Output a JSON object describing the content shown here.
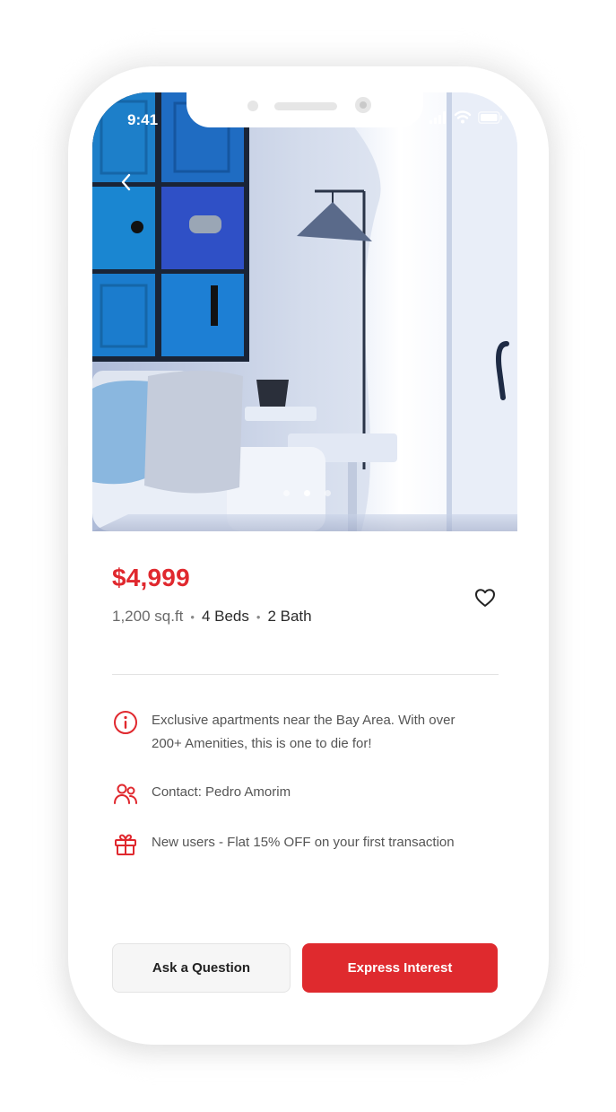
{
  "status_bar": {
    "time": "9:41"
  },
  "listing": {
    "price": "$4,999",
    "area": "1,200 sq.ft",
    "beds": "4 Beds",
    "baths": "2 Bath",
    "separator": "•"
  },
  "info": [
    {
      "icon": "info-icon",
      "text": "Exclusive apartments near the Bay Area. With over 200+ Amenities, this is one to die for!"
    },
    {
      "icon": "users-icon",
      "text": "Contact: Pedro Amorim"
    },
    {
      "icon": "gift-icon",
      "text": "New users - Flat 15% OFF on your first transaction"
    }
  ],
  "actions": {
    "ask_label": "Ask a Question",
    "express_label": "Express Interest"
  },
  "carousel": {
    "count": 3,
    "active_index": 1
  },
  "colors": {
    "accent": "#e0282e",
    "button_secondary": "#f6f6f6"
  }
}
